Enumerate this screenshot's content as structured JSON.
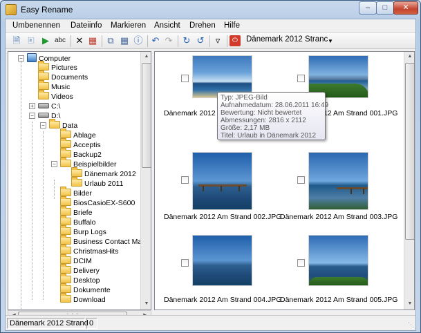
{
  "window": {
    "title": "Easy Rename",
    "icon": "folder-rename-icon"
  },
  "menu": [
    "Umbenennen",
    "Dateiinfo",
    "Markieren",
    "Ansicht",
    "Drehen",
    "Hilfe"
  ],
  "toolbar": {
    "buttons": [
      "new-icon",
      "open-icon",
      "play-icon",
      "spellcheck-icon",
      "delete-icon",
      "document-red-icon",
      "copy-icon",
      "table-icon",
      "info-icon",
      "undo-icon",
      "redo-icon",
      "rotate-right-icon",
      "rotate-left-icon",
      "filter-icon",
      "stop-icon"
    ],
    "spell_label": "abc",
    "folder_combo": "Dänemark 2012 Stranc"
  },
  "tree": {
    "computer": "Computer",
    "items": [
      {
        "label": "Pictures"
      },
      {
        "label": "Documents"
      },
      {
        "label": "Music"
      },
      {
        "label": "Videos"
      },
      {
        "label": "C:\\"
      },
      {
        "label": "D:\\"
      },
      {
        "label": "Data"
      },
      {
        "label": "Ablage"
      },
      {
        "label": "Acceptis"
      },
      {
        "label": "Backup2"
      },
      {
        "label": "Beispielbilder"
      },
      {
        "label": "Dänemark 2012"
      },
      {
        "label": "Urlaub 2011"
      },
      {
        "label": "Bilder"
      },
      {
        "label": "BiosCasioEX-S600"
      },
      {
        "label": "Briefe"
      },
      {
        "label": "Buffalo"
      },
      {
        "label": "Burp Logs"
      },
      {
        "label": "Business Contact Mana"
      },
      {
        "label": "ChristmasHits"
      },
      {
        "label": "DCIM"
      },
      {
        "label": "Delivery"
      },
      {
        "label": "Desktop"
      },
      {
        "label": "Dokumente"
      },
      {
        "label": "Download"
      }
    ]
  },
  "thumbnails": [
    {
      "caption": "Dänemark 2012 Am Strand 000.JPG"
    },
    {
      "caption": "Dänemark 2012 Am Strand 001.JPG"
    },
    {
      "caption": "Dänemark 2012 Am Strand 002.JPG"
    },
    {
      "caption": "Dänemark 2012 Am Strand 003.JPG"
    },
    {
      "caption": "Dänemark 2012 Am Strand 004.JPG"
    },
    {
      "caption": "Dänemark 2012 Am Strand 005.JPG"
    }
  ],
  "tooltip": {
    "type": "Typ: JPEG-Bild",
    "date": "Aufnahmedatum: 28.06.2011 16:49",
    "rating": "Bewertung: Nicht bewertet",
    "dimensions": "Abmessungen: 2816 x 2112",
    "size": "Größe: 2,17 MB",
    "title": "Titel: Urlaub in Dänemark 2012"
  },
  "status": {
    "folder": "Dänemark 2012 Strand",
    "count": "0"
  }
}
